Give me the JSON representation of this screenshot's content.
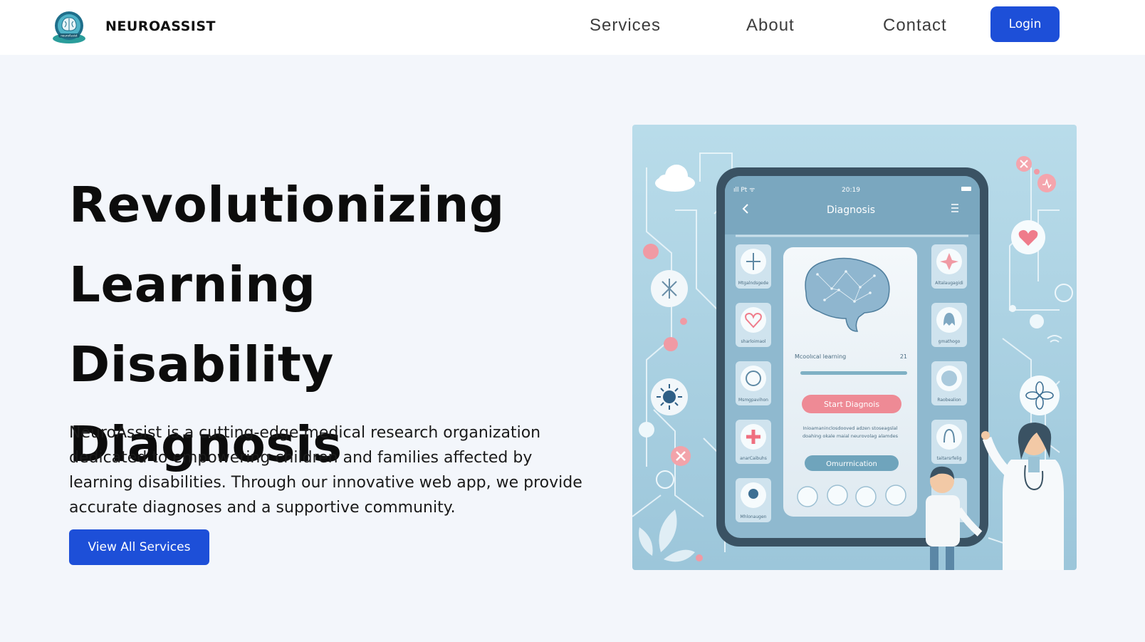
{
  "header": {
    "logo_text": "neuroAssist",
    "brand": "NEUROASSIST",
    "nav": {
      "services": "Services",
      "about": "About",
      "contact": "Contact"
    },
    "login_label": "Login"
  },
  "hero": {
    "title_lines": [
      "Revolutionizing",
      "Learning Disability",
      "Diagnosis"
    ],
    "description": "NeuroAssist is a cutting-edge medical research organization dedicated to empowering children and families affected by learning disabilities. Through our innovative web app, we provide accurate diagnoses and a supportive community.",
    "cta_label": "View All Services"
  },
  "illustration": {
    "status_left": "ıll Pt ᯤ",
    "status_time": "20:19",
    "screen_title": "Diagnosis",
    "card_label": "Mcoolıcal learning",
    "card_value": "21",
    "primary_button": "Start Diagnois",
    "card_text_1": "Inioamaninclosdooved adzen stoseagslal",
    "card_text_2": "doahing okale maial neurovolag alamdes",
    "secondary_button": "Omurrnication",
    "left_tiles": [
      "Mtgalndsgede",
      "sharloimaol",
      "Msmgpavihon",
      "anarCaibuhs",
      "Mhlonaugen"
    ],
    "right_tiles": [
      "Altalaugagidi",
      "gmathogo",
      "Raobealion",
      "taitarsrfelig"
    ],
    "colors": {
      "brand_blue": "#1d4fd8",
      "illustration_bg": "#a9d1e2",
      "accent_pink": "#ee8a95"
    }
  }
}
